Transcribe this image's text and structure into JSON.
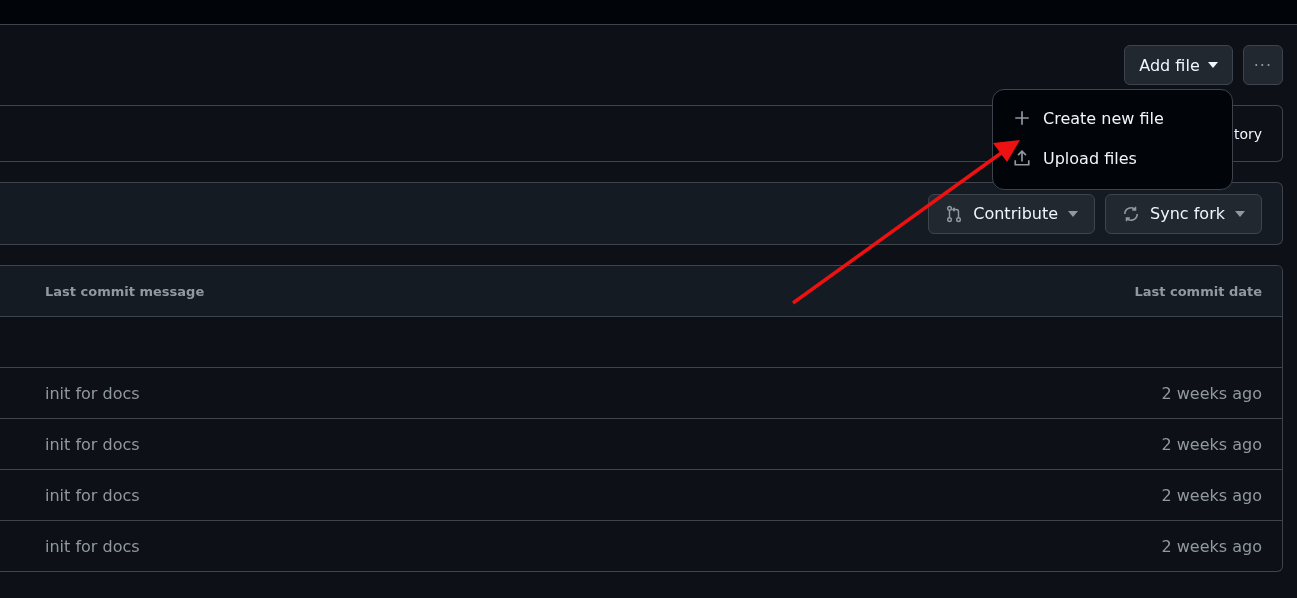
{
  "toolbar": {
    "add_file": "Add file",
    "more": "···"
  },
  "menu": {
    "items": [
      {
        "kind": "create",
        "label": "Create new file"
      },
      {
        "kind": "upload",
        "label": "Upload files"
      }
    ]
  },
  "history_bar": {
    "text": "tory"
  },
  "fork_bar": {
    "buttons": [
      {
        "kind": "contribute",
        "label": "Contribute"
      },
      {
        "kind": "sync",
        "label": "Sync fork"
      }
    ]
  },
  "table": {
    "columns": [
      "Last commit message",
      "Last commit date"
    ],
    "rows": [
      {
        "message": "init for docs",
        "date": "2 weeks ago"
      },
      {
        "message": "init for docs",
        "date": "2 weeks ago"
      },
      {
        "message": "init for docs",
        "date": "2 weeks ago"
      },
      {
        "message": "init for docs",
        "date": "2 weeks ago"
      }
    ]
  }
}
